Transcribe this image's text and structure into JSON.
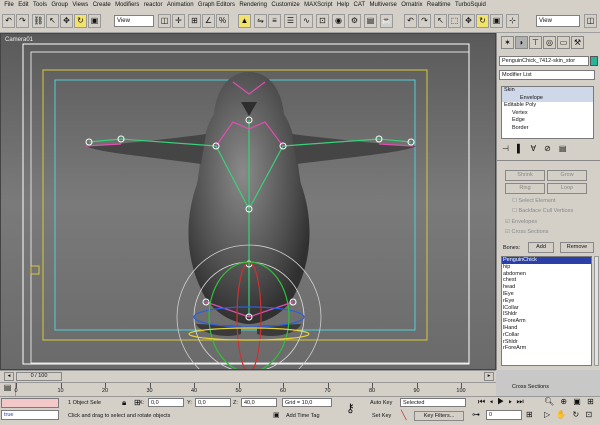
{
  "menu": [
    "File",
    "Edit",
    "Tools",
    "Group",
    "Views",
    "Create",
    "Modifiers",
    "reactor",
    "Animation",
    "Graph Editors",
    "Rendering",
    "Customize",
    "MAXScript",
    "Help",
    "CAT",
    "Multiverse",
    "Ornatrix",
    "Realtime",
    "TurboSquid"
  ],
  "toolbar": {
    "ref_coord": "View",
    "ref_coord2": "View"
  },
  "viewport": {
    "label": "Camera01"
  },
  "command_panel": {
    "object_name": "PenguinChick_7412-skin_stor",
    "color_swatch": "#2bb39a",
    "modifier_list": "Modifier List",
    "stack": [
      "Skin",
      "Envelope",
      "Editable Poly",
      "Vertex",
      "Edge",
      "Border"
    ],
    "select_buttons": [
      "Shrink",
      "Grow",
      "Ring",
      "Loop"
    ],
    "checks": [
      "Select Element",
      "Backface Cull Vertices",
      "Envelopes",
      "Cross Sections"
    ],
    "bones_label": "Bones:",
    "add_label": "Add",
    "remove_label": "Remove",
    "bones": [
      "PenguinChick",
      "hip",
      "abdomen",
      "chest",
      "head",
      "lEye",
      "rEye",
      "lCollar",
      "lShldr",
      "lForeArm",
      "lHand",
      "rCollar",
      "rShldr",
      "rForeArm"
    ],
    "cross_sections": "Cross Sections"
  },
  "timeslider": {
    "frame": "0 / 100"
  },
  "trackbar": {
    "ticks": [
      "0",
      "10",
      "20",
      "30",
      "40",
      "50",
      "60",
      "70",
      "80",
      "90",
      "100"
    ]
  },
  "status": {
    "maxscript_value": "true",
    "selection": "1 Object Sele",
    "prompt": "Click and drag to select and rotate objects",
    "x_label": "X:",
    "x_value": "0,0",
    "y_label": "Y:",
    "y_value": "0,0",
    "z_label": "Z:",
    "z_value": "40,0",
    "grid": "Grid = 10,0",
    "add_time_tag": "Add Time Tag",
    "auto_key": "Auto Key",
    "selected": "Selected",
    "set_key": "Set Key",
    "key_filters": "Key Filters...",
    "frame_field": "0"
  }
}
